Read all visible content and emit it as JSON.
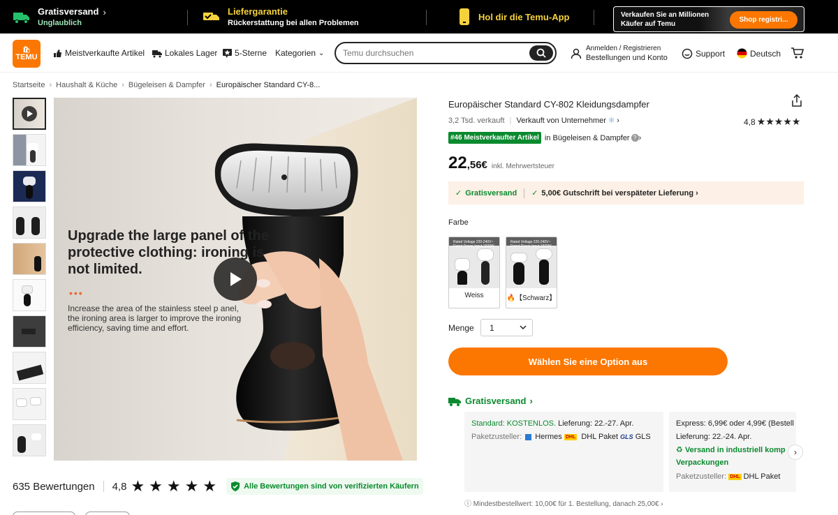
{
  "promo": {
    "shipping_title": "Gratisversand",
    "shipping_sub": "Unglaublich",
    "guarantee_title": "Liefergarantie",
    "guarantee_sub": "Rückerstattung bei allen Problemen",
    "app_text": "Hol dir die Temu-App",
    "banner_text": "Verkaufen Sie an Millionen Käufer auf Temu",
    "banner_button": "Shop registri..."
  },
  "header": {
    "logo_text": "TEMU",
    "nav": [
      "Meistverkaufte Artikel",
      "Lokales Lager",
      "5-Sterne",
      "Kategorien"
    ],
    "search_placeholder": "Temu durchsuchen",
    "account_line1": "Anmelden / Registrieren",
    "account_line2": "Bestellungen und Konto",
    "support": "Support",
    "language": "Deutsch"
  },
  "breadcrumb": [
    "Startseite",
    "Haushalt & Küche",
    "Bügeleisen & Dampfer",
    "Europäischer Standard CY-8..."
  ],
  "image": {
    "headline": "Upgrade the large panel of the protective clothing: ironing is not limited.",
    "dots": "•••",
    "body": "Increase the area of the stainless steel p anel, the ironing area is larger to improve the ironing efficiency, saving time and effort."
  },
  "reviews": {
    "count": "635 Bewertungen",
    "rating": "4,8",
    "stars": "★★★★★",
    "verified": "Alle Bewertungen sind von verifizierten Käufern"
  },
  "product": {
    "title": "Europäischer Standard CY-802 Kleidungsdampfer",
    "sold": "3,2 Tsd. verkauft",
    "seller": "Verkauft von Unternehmer",
    "rating": "4,8",
    "stars": "★★★★★",
    "rank_badge": "#46 Meistverkaufter Artikel",
    "rank_category": "in Bügeleisen & Dampfer",
    "price_main": "22",
    "price_cents": ",56€",
    "price_tax": "inkl. Mehrwertsteuer",
    "ship_free": "Gratisversand",
    "ship_credit": "5,00€ Gutschrift bei verspäteter Lieferung",
    "color_label": "Farbe",
    "options": [
      {
        "label": "Weiss",
        "mini": "Rated Voltage 220-240V~ Rated Power Input 1500W"
      },
      {
        "label": "【Schwarz】",
        "mini": "Rated Voltage 220-240V~ Rated Power Input 1500W"
      }
    ],
    "qty_label": "Menge",
    "qty_value": "1",
    "cta": "Wählen Sie eine Option aus"
  },
  "shipping": {
    "title": "Gratisversand",
    "standard_label": "Standard: KOSTENLOS.",
    "standard_delivery": "Lieferung: 22.-27. Apr.",
    "carriers_label": "Paketzusteller:",
    "carrier_1": "Hermes",
    "carrier_2": "DHL Paket",
    "carrier_3": "GLS",
    "express_line": "Express: 6,99€ oder 4,99€ (Bestell",
    "express_delivery": "Lieferung: 22.-24. Apr.",
    "eco": "Versand in industriell komp Verpackungen",
    "express_carrier": "DHL Paket",
    "min_order": "Mindestbestellwert: 10,00€ für 1. Bestellung, danach 25,00€"
  },
  "colors": {
    "accent": "#fb7701",
    "green": "#0a8a2e",
    "dark": "#000000"
  }
}
